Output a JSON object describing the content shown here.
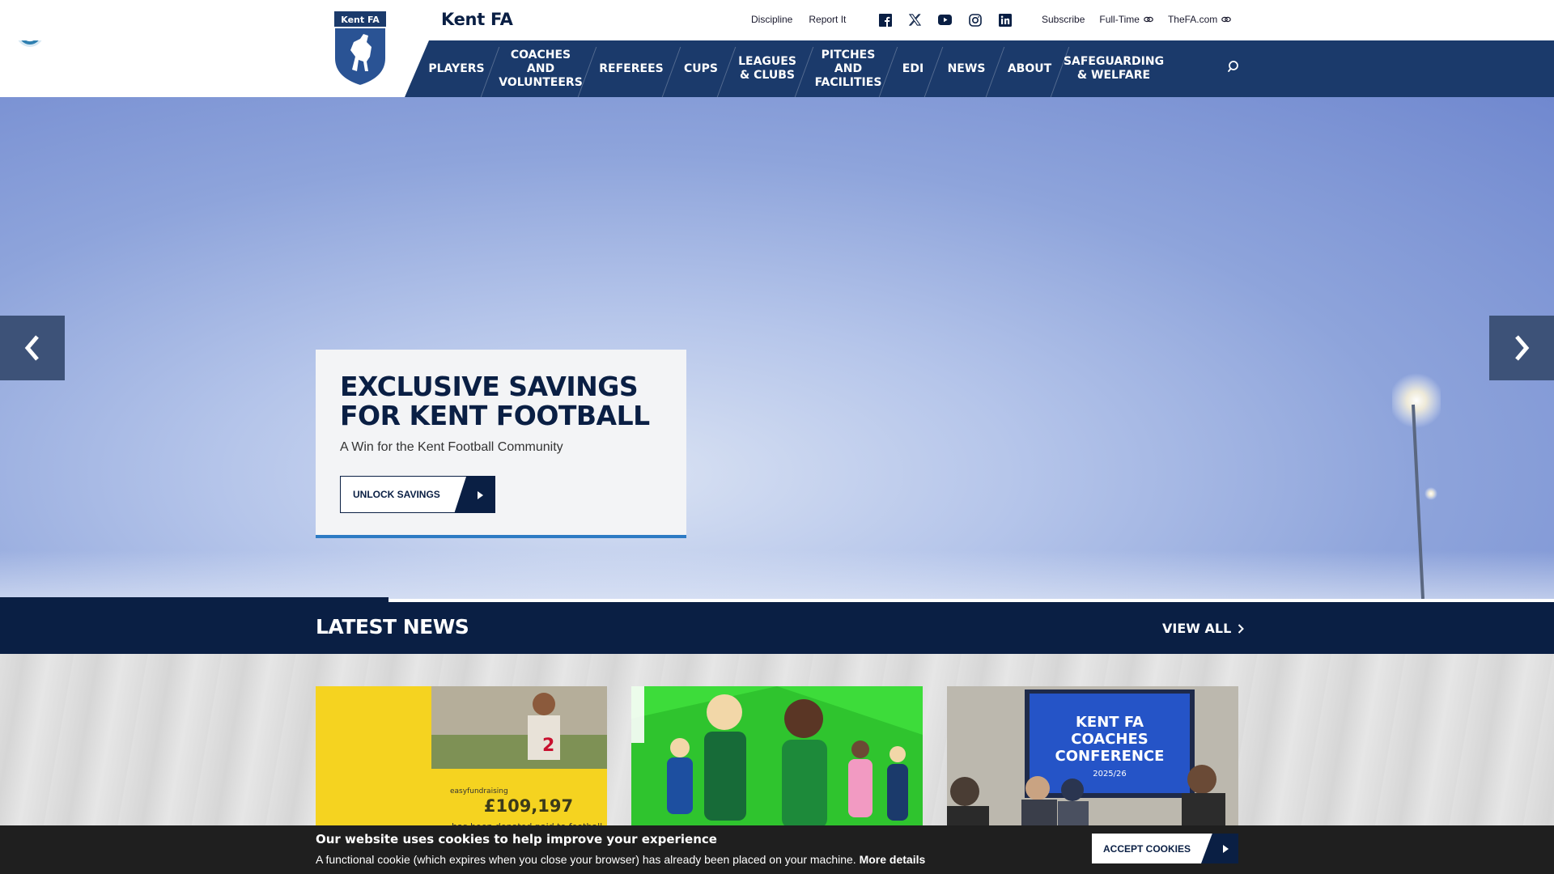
{
  "brand": {
    "crest_label": "Kent FA",
    "name": "Kent FA"
  },
  "util_links": [
    "Discipline",
    "Report It"
  ],
  "social": [
    "facebook-icon",
    "x-icon",
    "youtube-icon",
    "instagram-icon",
    "linkedin-icon"
  ],
  "ext_links": {
    "subscribe": "Subscribe",
    "fulltime": "Full-Time",
    "thefa": "TheFA.com"
  },
  "nav": [
    {
      "label": "PLAYERS"
    },
    {
      "label": "COACHES\nAND\nVOLUNTEERS"
    },
    {
      "label": "REFEREES"
    },
    {
      "label": "CUPS"
    },
    {
      "label": "LEAGUES\n& CLUBS"
    },
    {
      "label": "PITCHES\nAND\nFACILITIES"
    },
    {
      "label": "EDI"
    },
    {
      "label": "NEWS"
    },
    {
      "label": "ABOUT"
    },
    {
      "label": "SAFEGUARDING\n& WELFARE"
    }
  ],
  "hero": {
    "title": "EXCLUSIVE SAVINGS FOR KENT FOOTBALL",
    "subtitle": "A Win for the Kent Football Community",
    "button": "UNLOCK SAVINGS"
  },
  "news": {
    "title": "LATEST NEWS",
    "view_all": "VIEW ALL",
    "cards": [
      {
        "headline_image_text": "£109,197",
        "caption": "has been donated paid to football",
        "logo": "easyfundraising"
      },
      {
        "headline_image_text": "",
        "caption": "",
        "logo": ""
      },
      {
        "headline_image_text": "KENT FA COACHES CONFERENCE",
        "caption": "2025/26",
        "logo": ""
      }
    ]
  },
  "cookie": {
    "title": "Our website uses cookies to help improve your experience",
    "text": "A functional cookie (which expires when you close your browser) has already been placed on your machine.",
    "more": "More details",
    "button": "ACCEPT COOKIES"
  }
}
